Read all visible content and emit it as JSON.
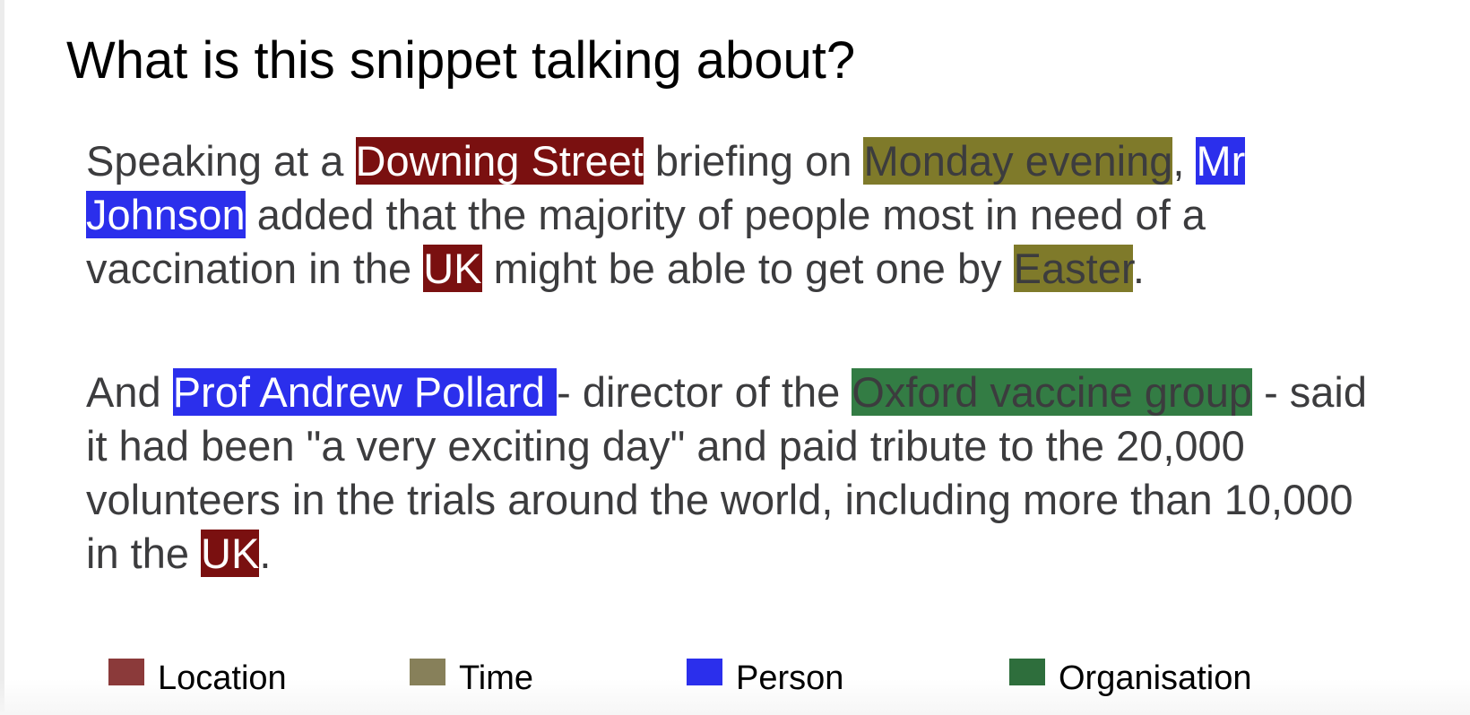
{
  "title": "What is this snippet talking about?",
  "colors": {
    "location": "#7a1010",
    "time": "#7f7a2a",
    "person": "#2b2fec",
    "organisation": "#337c44",
    "location_legend": "#8b3a3a",
    "time_legend": "#87805a",
    "person_legend": "#2b2fec",
    "organisation_legend": "#2e6e3c"
  },
  "paragraphs": [
    [
      {
        "text": "Speaking at a "
      },
      {
        "text": "Downing Street",
        "type": "location"
      },
      {
        "text": " briefing on "
      },
      {
        "text": "Monday evening",
        "type": "time"
      },
      {
        "text": ", "
      },
      {
        "text": "Mr Johnson",
        "type": "person"
      },
      {
        "text": " added that the majority of people most in need of a vaccination in the "
      },
      {
        "text": "UK",
        "type": "location"
      },
      {
        "text": " might be able to get one by "
      },
      {
        "text": "Easter",
        "type": "time"
      },
      {
        "text": "."
      }
    ],
    [
      {
        "text": "And "
      },
      {
        "text": "Prof Andrew Pollard ",
        "type": "person"
      },
      {
        "text": "- director of the "
      },
      {
        "text": "Oxford vaccine group",
        "type": "organisation"
      },
      {
        "text": " - said it had been \"a very exciting day\" and paid tribute to the 20,000 volunteers in the trials around the world, including more than 10,000 in the "
      },
      {
        "text": "UK",
        "type": "location"
      },
      {
        "text": "."
      }
    ]
  ],
  "legend": [
    {
      "type": "location",
      "label": "Location"
    },
    {
      "type": "time",
      "label": "Time"
    },
    {
      "type": "person",
      "label": "Person"
    },
    {
      "type": "organisation",
      "label": "Organisation"
    }
  ]
}
